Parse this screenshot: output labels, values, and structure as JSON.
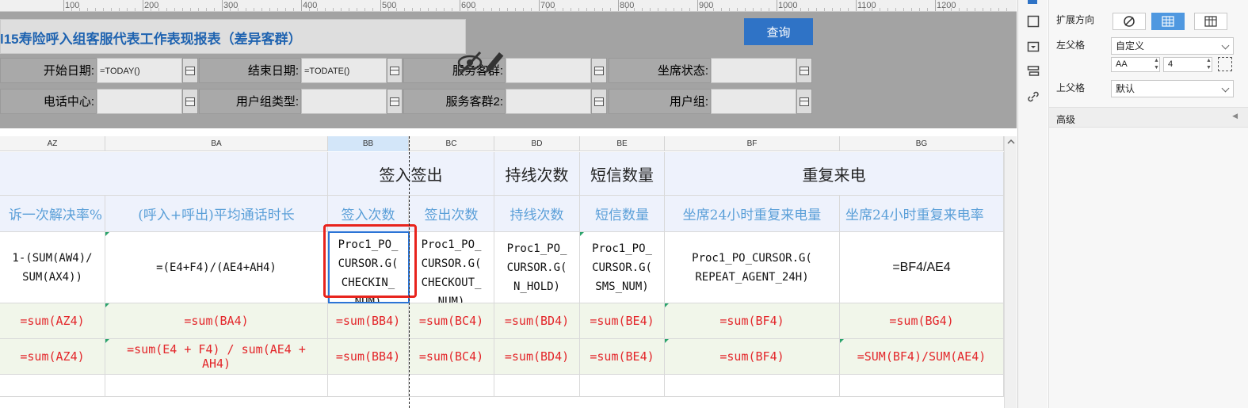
{
  "ruler": {
    "labels": [
      "100",
      "200",
      "300",
      "400",
      "500",
      "600",
      "700",
      "800",
      "900",
      "1000",
      "1100",
      "1200"
    ]
  },
  "report_title": "l15寿险呼入组客服代表工作表现报表（差异客群）",
  "query_button": "查询",
  "params": {
    "start_date_label": "开始日期:",
    "start_date_value": "=TODAY()",
    "end_date_label": "结束日期:",
    "end_date_value": "=TODATE()",
    "service_group_label": "服务客群:",
    "agent_status_label": "坐席状态:",
    "call_center_label": "电话中心:",
    "user_group_type_label": "用户组类型:",
    "service_group2_label": "服务客群2:",
    "user_group_label": "用户组:"
  },
  "columns": [
    "AZ",
    "BA",
    "BB",
    "BC",
    "BD",
    "BE",
    "BF",
    "BG"
  ],
  "group_headers": {
    "sign": "签入签出",
    "hold": "持线次数",
    "sms": "短信数量",
    "repeat": "重复来电"
  },
  "field_headers": [
    "诉一次解决率%",
    "(呼入+呼出)平均通话时长",
    "签入次数",
    "签出次数",
    "持线次数",
    "短信数量",
    "坐席24小时重复来电量",
    "坐席24小时重复来电率"
  ],
  "formulas": {
    "az": [
      "1-(SUM(AW4)/",
      "SUM(AX4))"
    ],
    "ba": [
      "=(E4+F4)/(AE4+AH4)"
    ],
    "bb": [
      "Proc1_PO_",
      "CURSOR.G(",
      "CHECKIN_",
      "NUM)"
    ],
    "bc": [
      "Proc1_PO_",
      "CURSOR.G(",
      "CHECKOUT_",
      "NUM)"
    ],
    "bd": [
      "Proc1_PO_",
      "CURSOR.G(",
      "N_HOLD)"
    ],
    "be": [
      "Proc1_PO_",
      "CURSOR.G(",
      "SMS_NUM)"
    ],
    "bf": [
      "Proc1_PO_CURSOR.G(",
      "REPEAT_AGENT_24H)"
    ],
    "bg": [
      "=BF4/AE4"
    ]
  },
  "sum_row1": [
    "=sum(AZ4)",
    "=sum(BA4)",
    "=sum(BB4)",
    "=sum(BC4)",
    "=sum(BD4)",
    "=sum(BE4)",
    "=sum(BF4)",
    "=sum(BG4)"
  ],
  "sum_row2": [
    "=sum(AZ4)",
    "=sum(E4 + F4) / sum(AE4 +",
    "AH4)",
    "=sum(BB4)",
    "=sum(BC4)",
    "=sum(BD4)",
    "=sum(BE4)",
    "=sum(BF4)",
    "=SUM(BF4)/SUM(AE4)"
  ],
  "right_panel": {
    "expand_direction_label": "扩展方向",
    "left_parent_label": "左父格",
    "left_parent_value": "自定义",
    "left_parent_col": "AA",
    "left_parent_row": "4",
    "top_parent_label": "上父格",
    "top_parent_value": "默认",
    "advanced_label": "高级"
  },
  "colors": {
    "accent": "#2f73c6",
    "formula_red": "#e3262a",
    "header_blue": "#5a9fd8",
    "selection": "#e8231c"
  }
}
